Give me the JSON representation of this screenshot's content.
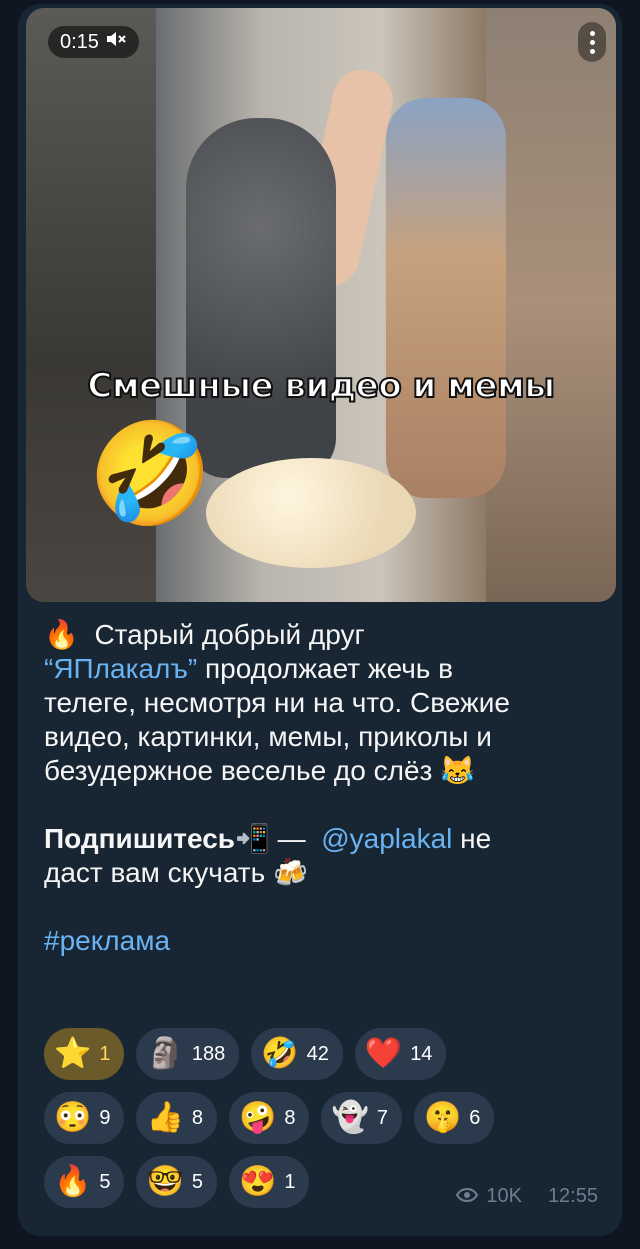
{
  "video": {
    "duration": "0:15",
    "mute_icon": "speaker-muted-icon",
    "overlay_title": "Смешные видео и мемы",
    "overlay_emoji": "🤣"
  },
  "caption": {
    "line1_emoji": "🔥",
    "line1": "Старый добрый друг",
    "link_yaplakal": "“ЯПлакалъ”",
    "line2_rest": "продолжает жечь в",
    "line3": "телеге, несмотря ни на что. Свежие",
    "line4": "видео, картинки, мемы, приколы и",
    "line5": "безудержное веселье до слёз",
    "line5_emoji": "😹",
    "subscribe_bold": "Подпишитесь",
    "subscribe_emoji": "📲",
    "dash": "—",
    "handle": "@yaplakal",
    "handle_rest": "не",
    "line7": "даст вам скучать",
    "line7_emoji": "🍻",
    "hashtag": "#реклама"
  },
  "reactions": {
    "row1": [
      {
        "emoji": "⭐",
        "count": "1"
      },
      {
        "emoji": "🗿",
        "count": "188"
      },
      {
        "emoji": "🤣",
        "count": "42"
      },
      {
        "emoji": "❤️",
        "count": "14"
      }
    ],
    "row2": [
      {
        "emoji": "😳",
        "count": "9"
      },
      {
        "emoji": "👍",
        "count": "8"
      },
      {
        "emoji": "🤪",
        "count": "8"
      },
      {
        "emoji": "👻",
        "count": "7"
      },
      {
        "emoji": "🤫",
        "count": "6"
      }
    ],
    "row3": [
      {
        "emoji": "🔥",
        "count": "5"
      },
      {
        "emoji": "🤓",
        "count": "5"
      },
      {
        "emoji": "😍",
        "count": "1"
      }
    ]
  },
  "meta": {
    "views": "10K",
    "time": "12:55",
    "views_icon": "eye-icon"
  }
}
